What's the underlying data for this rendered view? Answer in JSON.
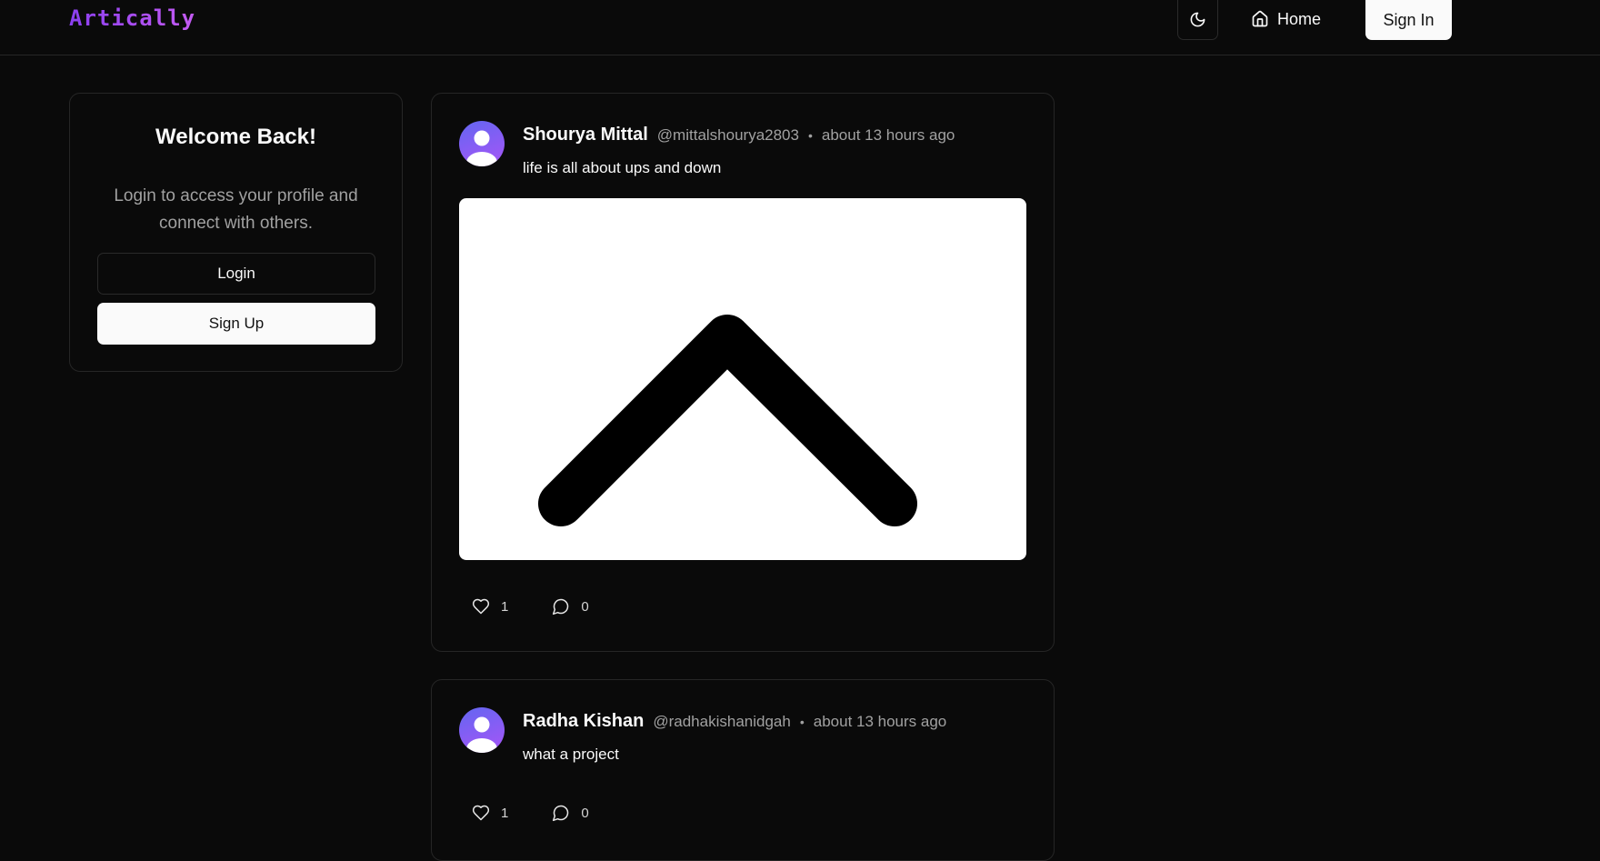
{
  "header": {
    "brand": "Artically",
    "home_label": "Home",
    "signin_label": "Sign In"
  },
  "welcome": {
    "title": "Welcome Back!",
    "subtitle": "Login to access your profile and connect with others.",
    "login_label": "Login",
    "signup_label": "Sign Up"
  },
  "posts": [
    {
      "author": "Shourya Mittal",
      "handle": "@mittalshourya2803",
      "separator": "•",
      "time": "about 13 hours ago",
      "text": "life is all about ups and down",
      "image_icon": "chevron-up-icon",
      "likes": "1",
      "comments": "0"
    },
    {
      "author": "Radha Kishan",
      "handle": "@radhakishanidgah",
      "separator": "•",
      "time": "about 13 hours ago",
      "text": "what a project",
      "likes": "1",
      "comments": "0"
    }
  ],
  "colors": {
    "background": "#0a0a0a",
    "border": "#262626",
    "brand_gradient_start": "#8b3ff0",
    "brand_gradient_end": "#c45bf2",
    "avatar_gradient_start": "#6366f1",
    "avatar_gradient_end": "#a855f7"
  }
}
